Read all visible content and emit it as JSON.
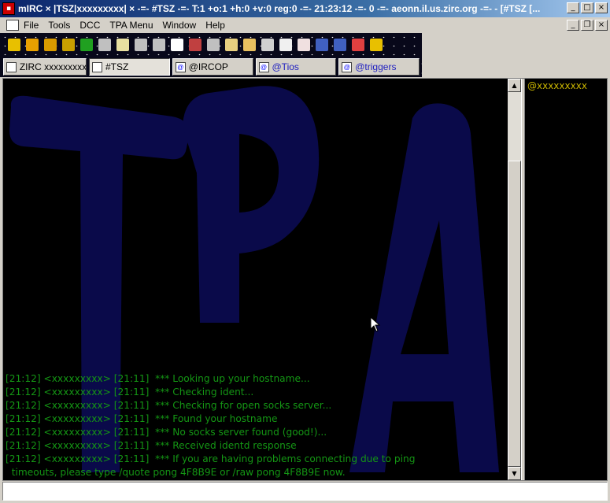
{
  "window": {
    "title": "mIRC × |TSZ|xxxxxxxxx| × -=- #TSZ -=- T:1 +o:1 +h:0 +v:0 reg:0 -=- 21:23:12 -=- 0 -=- aeonn.il.us.zirc.org -=- - [#TSZ [...",
    "minimize": "_",
    "maximize": "□",
    "close": "×"
  },
  "menu": {
    "items": [
      "File",
      "Tools",
      "DCC",
      "TPA Menu",
      "Window",
      "Help"
    ],
    "mdi_minimize": "_",
    "mdi_restore": "❐",
    "mdi_close": "×"
  },
  "toolbar": {
    "icons": [
      {
        "name": "connect-icon",
        "color": "#e8c000"
      },
      {
        "name": "options-icon",
        "color": "#e8a000"
      },
      {
        "name": "favorites-icon",
        "color": "#d89a00"
      },
      {
        "name": "channels-list-icon",
        "color": "#c8a000"
      },
      {
        "name": "scripts-icon",
        "color": "#20a020"
      },
      {
        "name": "address-book-icon",
        "color": "#c0c0c0"
      },
      {
        "name": "colors-icon",
        "color": "#e8e0a0"
      },
      {
        "name": "dcc-send-icon",
        "color": "#c0c0c0"
      },
      {
        "name": "dcc-chat-icon",
        "color": "#c0c0c0"
      },
      {
        "name": "timer-icon",
        "color": "#ffffff"
      },
      {
        "name": "notify-icon",
        "color": "#c04040"
      },
      {
        "name": "list-icon",
        "color": "#c0c0c0"
      },
      {
        "name": "tpa-icon-1",
        "color": "#e8d080"
      },
      {
        "name": "tpa-icon-2",
        "color": "#e8c060"
      },
      {
        "name": "tpa-icon-3",
        "color": "#d0d0d0"
      },
      {
        "name": "notes-icon",
        "color": "#f0f0f0"
      },
      {
        "name": "log-icon",
        "color": "#f0e0e0"
      },
      {
        "name": "tile-icon",
        "color": "#4060c0"
      },
      {
        "name": "cascade-icon",
        "color": "#4060c0"
      },
      {
        "name": "help-icon",
        "color": "#e04040"
      },
      {
        "name": "about-icon",
        "color": "#e8c000"
      }
    ]
  },
  "switchbar": {
    "tabs": [
      {
        "label": "ZIRC xxxxxxxxx",
        "icon": "status-window-icon",
        "active": false,
        "kind": "status"
      },
      {
        "label": "#TSZ",
        "icon": "channel-window-icon",
        "active": true,
        "kind": "channel-active"
      },
      {
        "label": "@IRCOP",
        "icon": "query-window-icon",
        "active": false,
        "kind": "query"
      },
      {
        "label": "@Tios",
        "icon": "query-window-icon",
        "active": false,
        "kind": "channel"
      },
      {
        "label": "@triggers",
        "icon": "query-window-icon",
        "active": false,
        "kind": "channel"
      }
    ]
  },
  "channel": {
    "background_text": "TPA",
    "background_color": "#0a0a4a",
    "text_color": "#149614",
    "lines": [
      "[21:12] <xxxxxxxxx> [21:11]  *** Looking up your hostname...",
      "[21:12] <xxxxxxxxx> [21:11]  *** Checking ident...",
      "[21:12] <xxxxxxxxx> [21:11]  *** Checking for open socks server...",
      "[21:12] <xxxxxxxxx> [21:11]  *** Found your hostname",
      "[21:12] <xxxxxxxxx> [21:11]  *** No socks server found (good!)...",
      "[21:12] <xxxxxxxxx> [21:11]  *** Received identd response",
      "[21:12] <xxxxxxxxx> [21:11]  *** If you are having problems connecting due to ping",
      "  timeouts, please type /quote pong 4F8B9E or /raw pong 4F8B9E now."
    ]
  },
  "nicklist": {
    "nicks": [
      "@xxxxxxxxx"
    ],
    "color": "#c8b400"
  },
  "editbox": {
    "value": ""
  }
}
